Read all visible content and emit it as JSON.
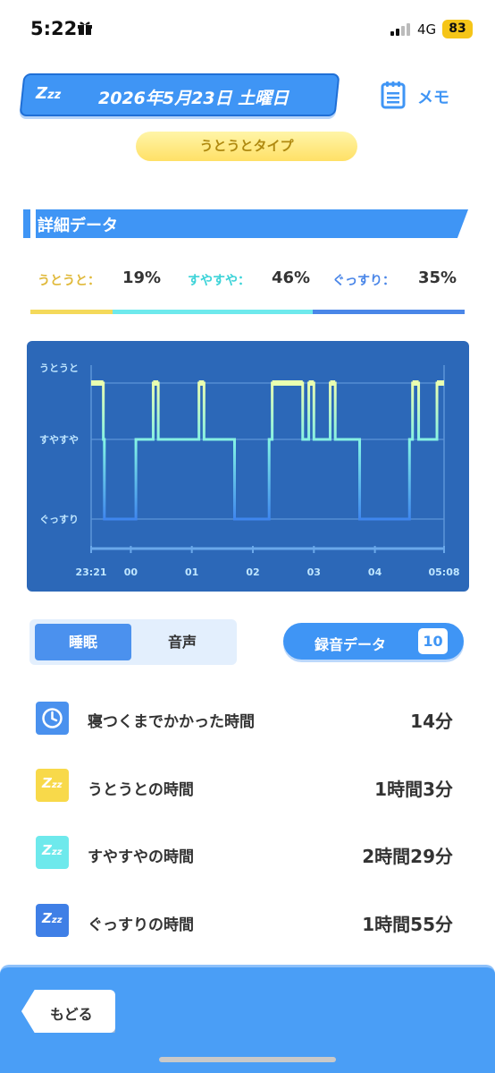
{
  "status": {
    "time": "5:22",
    "network": "4G",
    "battery": "83"
  },
  "header": {
    "date": "2026年5月23日 土曜日",
    "memo_label": "メモ",
    "sleep_type": "うとうとタイプ"
  },
  "section": {
    "title": "詳細データ"
  },
  "ratios": [
    {
      "label": "うとうと：",
      "value": "19%",
      "percent": 19,
      "color": "#f4d95a"
    },
    {
      "label": "すやすや：",
      "value": "46%",
      "percent": 46,
      "color": "#6ee9ec"
    },
    {
      "label": "ぐっすり：",
      "value": "35%",
      "percent": 35,
      "color": "#4a86e8"
    }
  ],
  "chart_data": {
    "type": "line",
    "step": true,
    "y_levels": [
      "うとうと",
      "すやすや",
      "ぐっすり"
    ],
    "x_ticks": [
      "23:21",
      "00",
      "01",
      "02",
      "03",
      "04",
      "05:08"
    ],
    "x_range_minutes": [
      0,
      347
    ],
    "series": [
      {
        "segments": [
          {
            "start": 0,
            "end": 12,
            "level": "うとうと"
          },
          {
            "start": 12,
            "end": 13,
            "level": "すやすや"
          },
          {
            "start": 13,
            "end": 44,
            "level": "ぐっすり"
          },
          {
            "start": 44,
            "end": 61,
            "level": "すやすや"
          },
          {
            "start": 61,
            "end": 66,
            "level": "うとうと"
          },
          {
            "start": 66,
            "end": 106,
            "level": "すやすや"
          },
          {
            "start": 106,
            "end": 111,
            "level": "うとうと"
          },
          {
            "start": 111,
            "end": 141,
            "level": "すやすや"
          },
          {
            "start": 141,
            "end": 175,
            "level": "ぐっすり"
          },
          {
            "start": 175,
            "end": 178,
            "level": "すやすや"
          },
          {
            "start": 178,
            "end": 208,
            "level": "うとうと"
          },
          {
            "start": 208,
            "end": 214,
            "level": "すやすや"
          },
          {
            "start": 214,
            "end": 219,
            "level": "うとうと"
          },
          {
            "start": 219,
            "end": 235,
            "level": "すやすや"
          },
          {
            "start": 235,
            "end": 240,
            "level": "うとうと"
          },
          {
            "start": 240,
            "end": 264,
            "level": "すやすや"
          },
          {
            "start": 264,
            "end": 313,
            "level": "ぐっすり"
          },
          {
            "start": 313,
            "end": 316,
            "level": "すやすや"
          },
          {
            "start": 316,
            "end": 322,
            "level": "うとうと"
          },
          {
            "start": 322,
            "end": 340,
            "level": "すやすや"
          },
          {
            "start": 340,
            "end": 347,
            "level": "うとうと"
          }
        ]
      }
    ],
    "grid": true
  },
  "tabs": {
    "active": "睡眠",
    "inactive": "音声"
  },
  "recording": {
    "label": "録音データ",
    "count": "10"
  },
  "rows": [
    {
      "label": "寝つくまでかかった時間",
      "value": "14分",
      "icon": "clock-icon",
      "color": "#4a91ee"
    },
    {
      "label": "うとうとの時間",
      "value": "1時間3分",
      "icon": "zzz-icon",
      "color": "#f8d94a"
    },
    {
      "label": "すやすやの時間",
      "value": "2時間29分",
      "icon": "zzz-icon",
      "color": "#6ee9ec"
    },
    {
      "label": "ぐっすりの時間",
      "value": "1時間55分",
      "icon": "zzz-icon",
      "color": "#3f7fe6"
    }
  ],
  "footer": {
    "back_label": "もどる"
  }
}
